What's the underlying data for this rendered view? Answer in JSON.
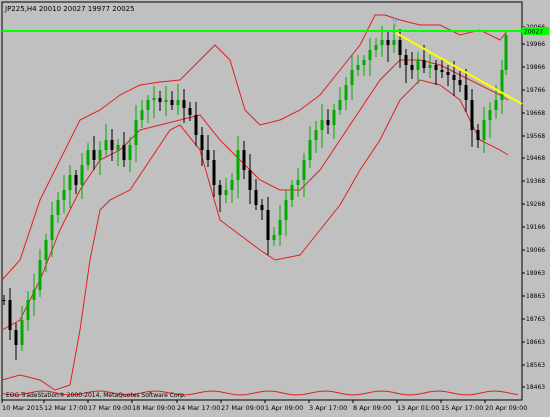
{
  "header": {
    "symbol_line": "JP225,H4  20010 20027 19977 20025"
  },
  "price_axis": {
    "labels": [
      "20066",
      "19966",
      "19866",
      "19766",
      "19668",
      "19568",
      "19468",
      "19368",
      "19268",
      "19166",
      "19066",
      "18963",
      "18863",
      "18763",
      "18663",
      "18563",
      "18463"
    ],
    "current_price": "20027"
  },
  "time_axis": {
    "labels": [
      "10 Mar 2015",
      "12 Mar 17:00",
      "17 Mar 09:00",
      "18 Mar 09:00",
      "24 Mar 17:00",
      "27 Mar 09:00",
      "1 Apr 09:00",
      "3 Apr 17:00",
      "8 Apr 09:00",
      "13 Apr 01:00",
      "15 Apr 17:00",
      "20 Apr 09:00"
    ]
  },
  "watermark": {
    "text": "EOG TradeStation® 2000-2014, MetaQuotes Software Corp."
  },
  "colors": {
    "background": "#c0c0c0",
    "bull_candle": "#00aa00",
    "bear_candle": "#000000",
    "bands": "#e02020",
    "horizontal_level": "#00ff00",
    "trendline": "#ffff00",
    "arrow": "#8080ff"
  },
  "chart_data": {
    "type": "candlestick",
    "title": "JP225,H4",
    "ohlc_header": {
      "open": 20010,
      "high": 20027,
      "low": 19977,
      "close": 20025
    },
    "ylim": [
      18423,
      20106
    ],
    "horizontal_level": 20027,
    "overlays": [
      "bollinger_bands_upper",
      "bollinger_bands_middle",
      "bollinger_bands_lower",
      "trendline",
      "horizontal_level"
    ]
  }
}
